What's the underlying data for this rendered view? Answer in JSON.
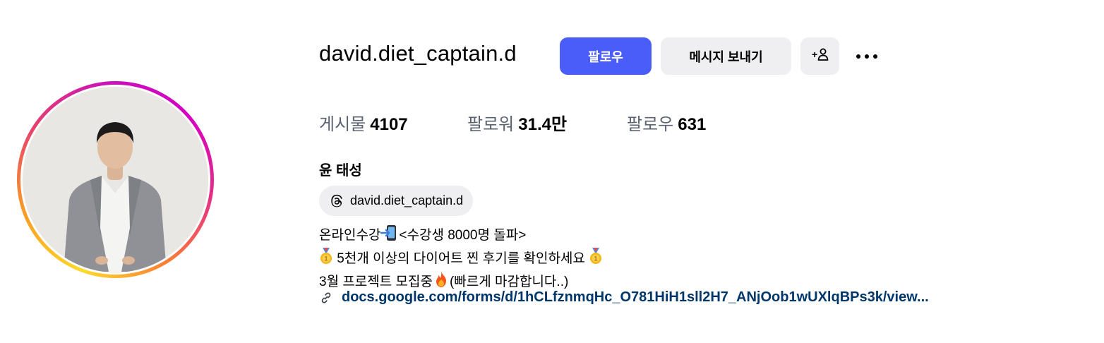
{
  "profile": {
    "username": "david.diet_captain.d",
    "full_name": "윤 태성"
  },
  "actions": {
    "follow_label": "팔로우",
    "message_label": "메시지 보내기",
    "add_user_icon": "person-add-icon",
    "more_icon": "more-horizontal-icon"
  },
  "stats": [
    {
      "label": "게시물",
      "value": "4107"
    },
    {
      "label": "팔로워",
      "value": "31.4만"
    },
    {
      "label": "팔로우",
      "value": "631"
    }
  ],
  "threads": {
    "handle": "david.diet_captain.d",
    "icon": "threads-icon"
  },
  "bio": {
    "line1_a": "온라인수강",
    "line1_b": "<수강생 8000명 돌파>",
    "line2": "5천개 이상의 다이어트 찐 후기를 확인하세요",
    "line3_a": "3월 프로젝트 모집중",
    "line3_b": "(빠르게 마감합니다..)"
  },
  "link": {
    "text": "docs.google.com/forms/d/1hCLfznmqHc_O781HiH1sll2H7_ANjOob1wUXlqBPs3k/view...",
    "icon": "link-icon"
  },
  "colors": {
    "follow_button": "#4a5df9",
    "secondary_button": "#efeff2",
    "link": "#00376b",
    "stat_label": "#5b6270"
  }
}
